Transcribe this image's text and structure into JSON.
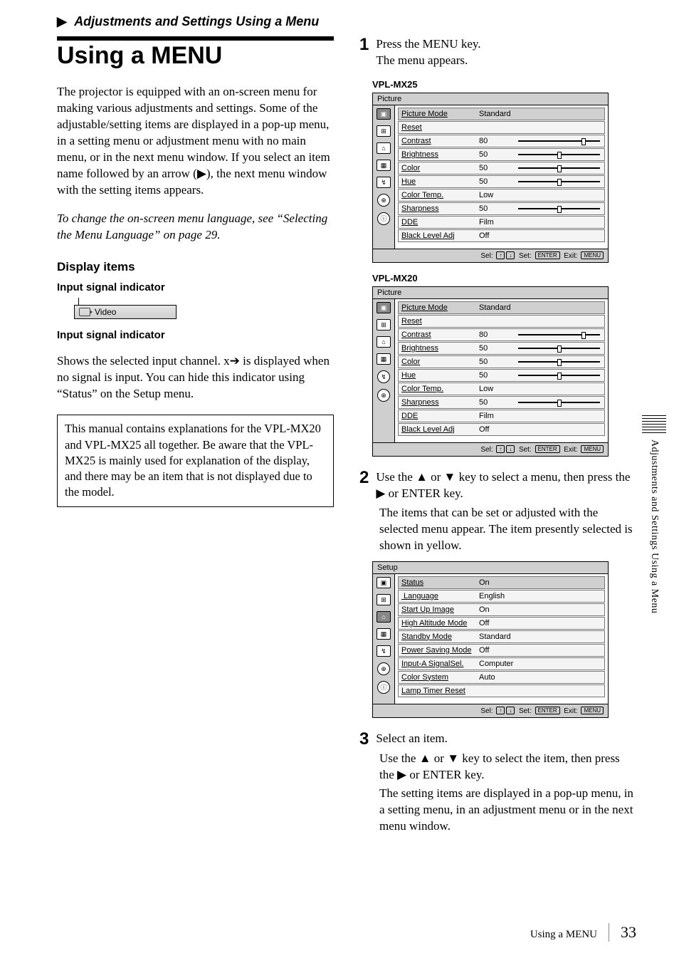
{
  "section_heading": "Adjustments and Settings Using a Menu",
  "h1": "Using a MENU",
  "intro": "The projector is equipped with an on-screen menu for making various adjustments and settings. Some of the adjustable/setting items are displayed in a pop-up menu, in a setting menu or adjustment menu with no main menu, or in the next menu window. If you select an item name followed by an arrow (▶), the next menu window with the setting items appears.",
  "intro_note": "To change the on-screen menu language, see “Selecting the Menu Language” on page 29.",
  "display_items_heading": "Display items",
  "input_indicator_label": "Input signal indicator",
  "video_label": "Video",
  "input_indicator_heading": "Input signal indicator",
  "input_indicator_body": "Shows the selected input channel. x➔ is displayed when no signal is input. You can hide this indicator using “Status” on the Setup menu.",
  "manual_note": "This manual contains explanations for the VPL-MX20 and VPL-MX25 all together. Be aware that the VPL-MX25 is mainly used for explanation of the display, and there may be an item that is not displayed due to the model.",
  "steps": {
    "s1a": "Press the MENU key.",
    "s1b": "The menu appears.",
    "s2a": "Use the ▲ or ▼ key to select a menu, then press the ▶ or ENTER key.",
    "s2b": "The items that can be set or adjusted with the selected menu appear. The item presently selected is shown in yellow.",
    "s3a": "Select an item.",
    "s3b": "Use the ▲ or ▼ key to select the item, then press the ▶ or ENTER key.",
    "s3c": "The setting items are displayed in a pop-up menu, in a setting menu, in an adjustment menu or in the next menu window."
  },
  "models": {
    "mx25": "VPL-MX25",
    "mx20": "VPL-MX20"
  },
  "osd_foot": {
    "sel": "Sel:",
    "set": "Set:",
    "exit": "Exit:",
    "enter": "ENTER",
    "menu": "MENU"
  },
  "picture_menu": {
    "title": "Picture",
    "rows": [
      {
        "label": "Picture Mode",
        "value": "Standard",
        "slider": null,
        "hi": true
      },
      {
        "label": "Reset",
        "value": "",
        "slider": null
      },
      {
        "label": "Contrast",
        "value": "80",
        "slider": 80
      },
      {
        "label": "Brightness",
        "value": "50",
        "slider": 50
      },
      {
        "label": "Color",
        "value": "50",
        "slider": 50
      },
      {
        "label": "Hue",
        "value": "50",
        "slider": 50
      },
      {
        "label": "Color Temp.",
        "value": "Low",
        "slider": null
      },
      {
        "label": "Sharpness",
        "value": "50",
        "slider": 50
      },
      {
        "label": "DDE",
        "value": "Film",
        "slider": null
      },
      {
        "label": "Black Level Adj",
        "value": "Off",
        "slider": null
      }
    ]
  },
  "setup_menu": {
    "title": "Setup",
    "rows": [
      {
        "label": "Status",
        "value": "On",
        "hi": true
      },
      {
        "label": " Language",
        "value": "English"
      },
      {
        "label": "Start Up Image",
        "value": "On"
      },
      {
        "label": "High Altitude Mode",
        "value": "Off"
      },
      {
        "label": "Standby Mode",
        "value": "Standard"
      },
      {
        "label": "Power Saving Mode",
        "value": "Off"
      },
      {
        "label": "Input-A SignalSel.",
        "value": "Computer"
      },
      {
        "label": "Color System",
        "value": "Auto"
      },
      {
        "label": "Lamp Timer Reset",
        "value": ""
      }
    ]
  },
  "side_tab": "Adjustments and Settings Using a Menu",
  "footer_title": "Using a MENU",
  "page_number": "33"
}
